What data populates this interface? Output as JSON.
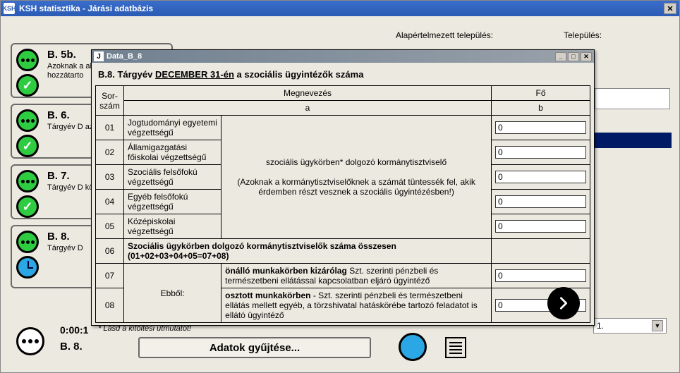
{
  "window": {
    "title": "KSH statisztika - Járási adatbázis",
    "icon_label": "KSH"
  },
  "top_labels": {
    "alap": "Alapértelmezett település:",
    "telep": "Település:"
  },
  "cards": [
    {
      "code": "B. 5b.",
      "desc": "Azoknak a\nakik otthor\njogosultsá\nhozzátarto"
    },
    {
      "code": "B. 6.",
      "desc": "Tárgyév D\naz egy főre\njogosultsá"
    },
    {
      "code": "B. 7.",
      "desc": "Tárgyév D\nközgyógy"
    },
    {
      "code": "B. 8.",
      "desc": "Tárgyév D"
    }
  ],
  "bottom": {
    "timer": "0:00:1",
    "code": "B. 8.",
    "gather": "Adatok gyűjtése..."
  },
  "dropdown": {
    "value": "1."
  },
  "modal": {
    "title": "Data_B_8",
    "icon": "J",
    "heading_prefix": "B.8. Tárgyév ",
    "heading_underlined": "DECEMBER 31-én",
    "heading_suffix": " a szociális ügyintézők száma",
    "col_sor": "Sor-\nszám",
    "col_meg": "Megnevezés",
    "col_fo": "Fő",
    "sub_a": "a",
    "sub_b": "b",
    "side_note_top": "szociális ügykörben* dolgozó kormánytisztviselő",
    "side_note_bottom": "(Azoknak a kormánytisztviselőknek a számát tüntessék fel, akik érdemben részt vesznek a szociális ügyintézésben!)",
    "rows": [
      {
        "n": "01",
        "label": "Jogtudományi egyetemi végzettségű",
        "val": "0"
      },
      {
        "n": "02",
        "label": "Államigazgatási főiskolai végzettségű",
        "val": "0"
      },
      {
        "n": "03",
        "label": "Szociális felsőfokú végzettségű",
        "val": "0"
      },
      {
        "n": "04",
        "label": "Egyéb felsőfokú végzettségű",
        "val": "0"
      },
      {
        "n": "05",
        "label": "Középiskolai végzettségű",
        "val": "0"
      }
    ],
    "row06_n": "06",
    "row06_label": "Szociális ügykörben dolgozó kormánytisztviselők száma összesen (01+02+03+04+05=07+08)",
    "ebbol": "Ebből:",
    "row07_n": "07",
    "row07_label_b": "önálló munkakörben kizárólag",
    "row07_label_r": " Szt. szerinti pénzbeli és természetbeni ellátással kapcsolatban eljáró ügyintéző",
    "row07_val": "0",
    "row08_n": "08",
    "row08_label_b": "osztott munkakörben",
    "row08_label_r": " - Szt. szerinti pénzbeli és természetbeni ellátás mellett egyéb, a törzshivatal hatáskörébe tartozó feladatot is ellátó ügyintéző",
    "row08_val": "0",
    "footnote": "* Lásd a kitöltési útmutatót!"
  }
}
